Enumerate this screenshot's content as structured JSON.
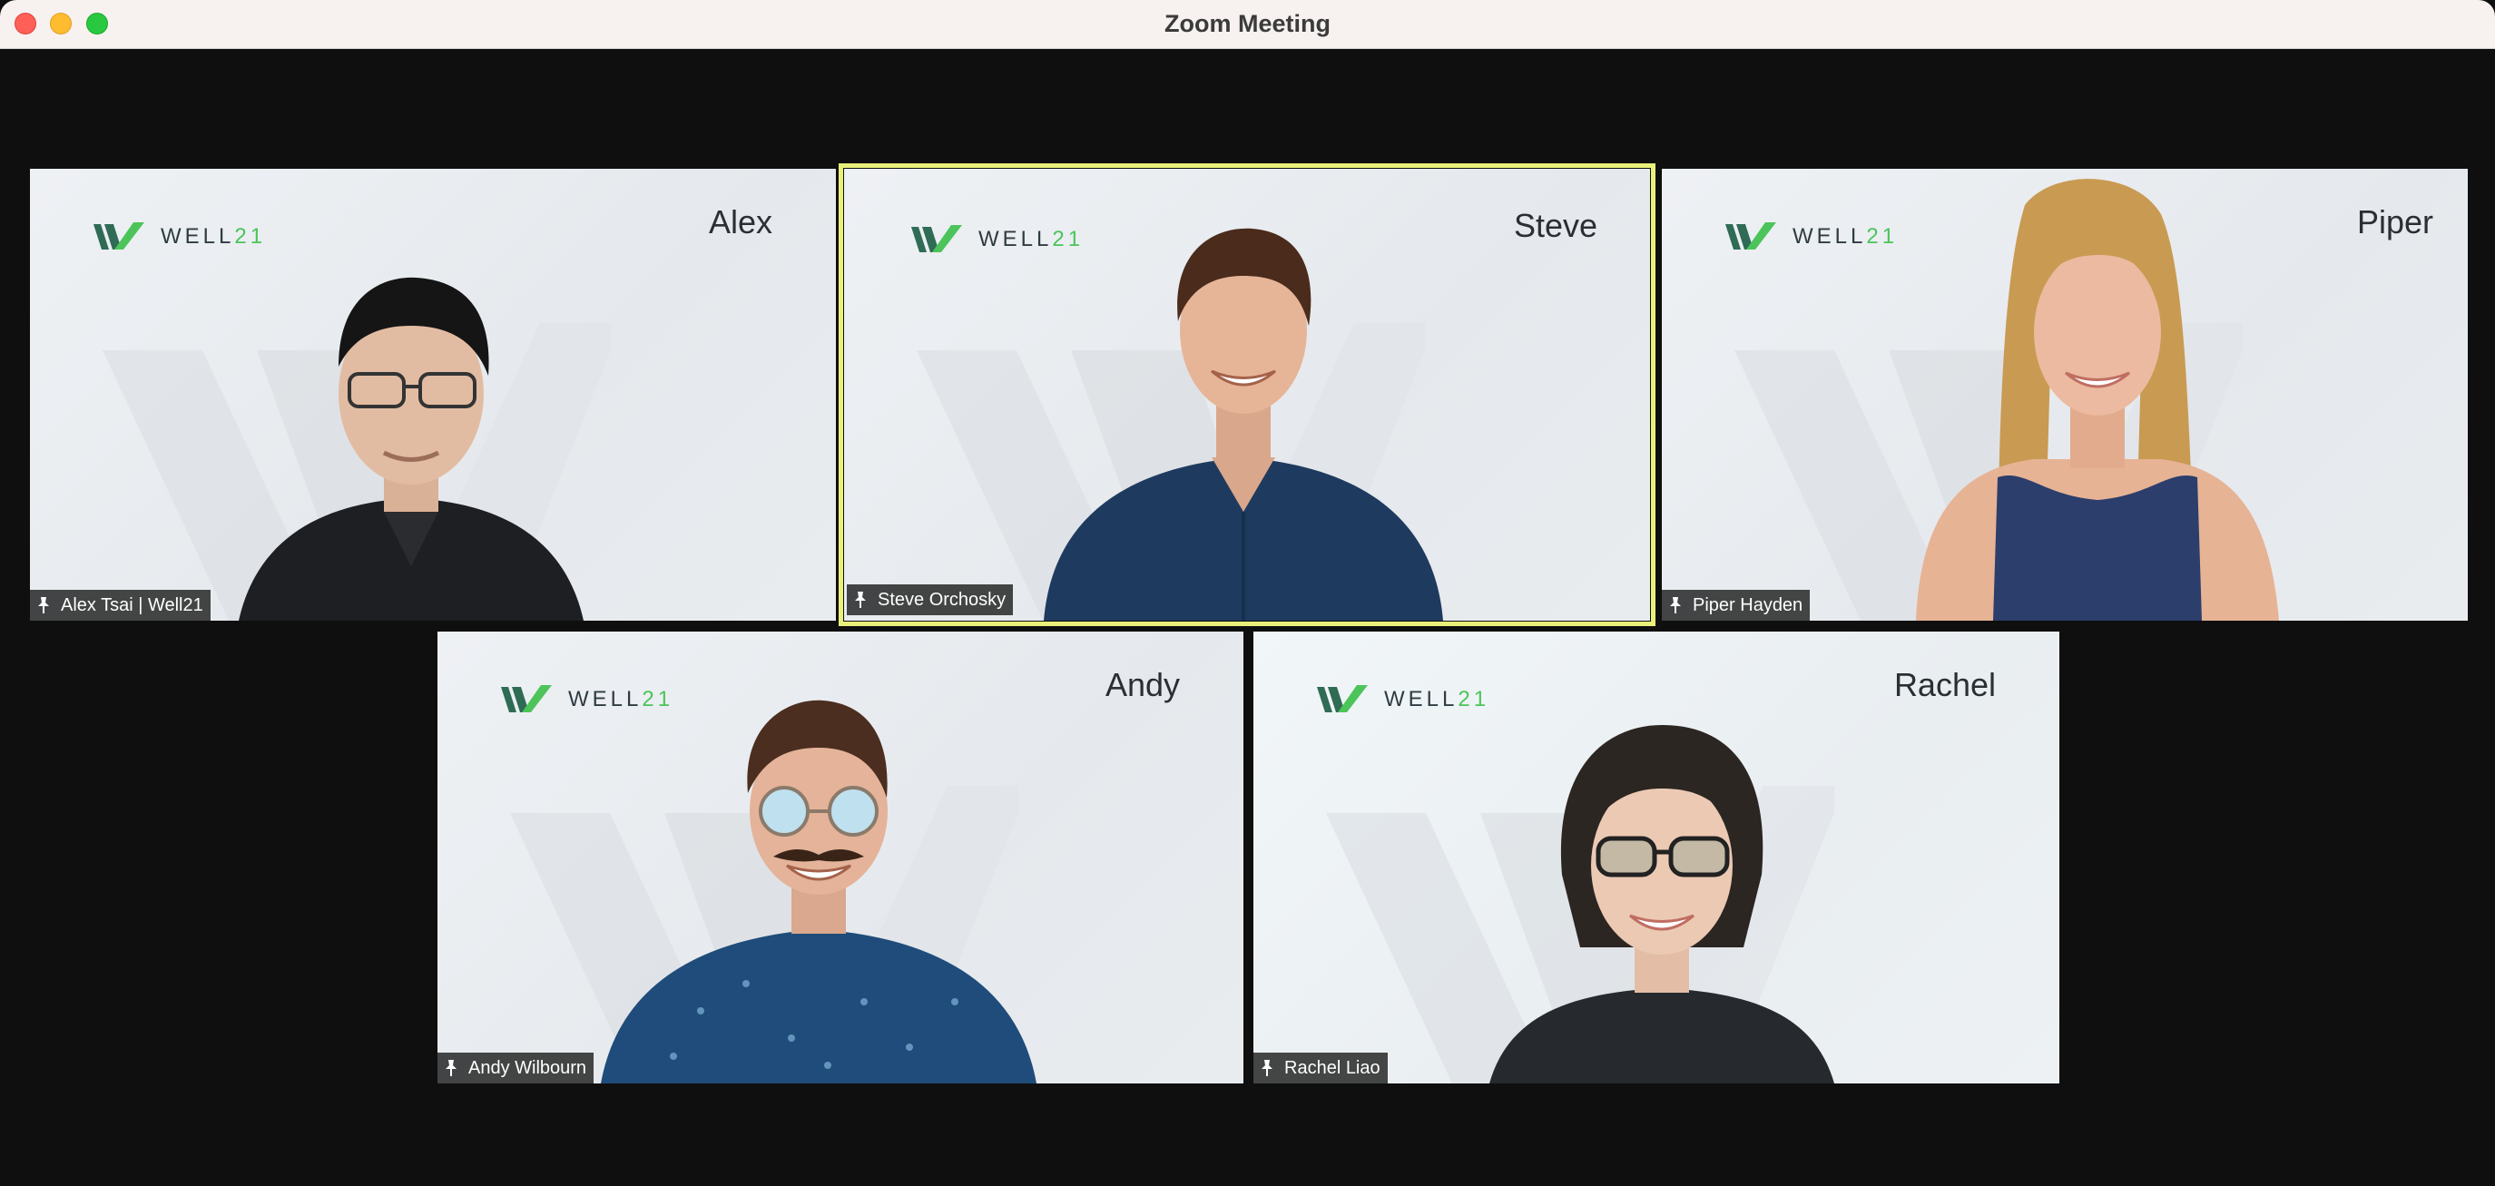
{
  "window": {
    "title": "Zoom Meeting"
  },
  "brand": {
    "logo_text": "WELL",
    "logo_num": "21",
    "colors": {
      "dark_green": "#2f6b55",
      "green": "#4cc45a",
      "active_outline": "#e9f07a"
    }
  },
  "participants": [
    {
      "first_name": "Alex",
      "label": "Alex Tsai | Well21",
      "active": false
    },
    {
      "first_name": "Steve",
      "label": "Steve Orchosky",
      "active": true
    },
    {
      "first_name": "Piper",
      "label": "Piper Hayden",
      "active": false
    },
    {
      "first_name": "Andy",
      "label": "Andy Wilbourn",
      "active": false
    },
    {
      "first_name": "Rachel",
      "label": "Rachel Liao",
      "active": false
    }
  ]
}
